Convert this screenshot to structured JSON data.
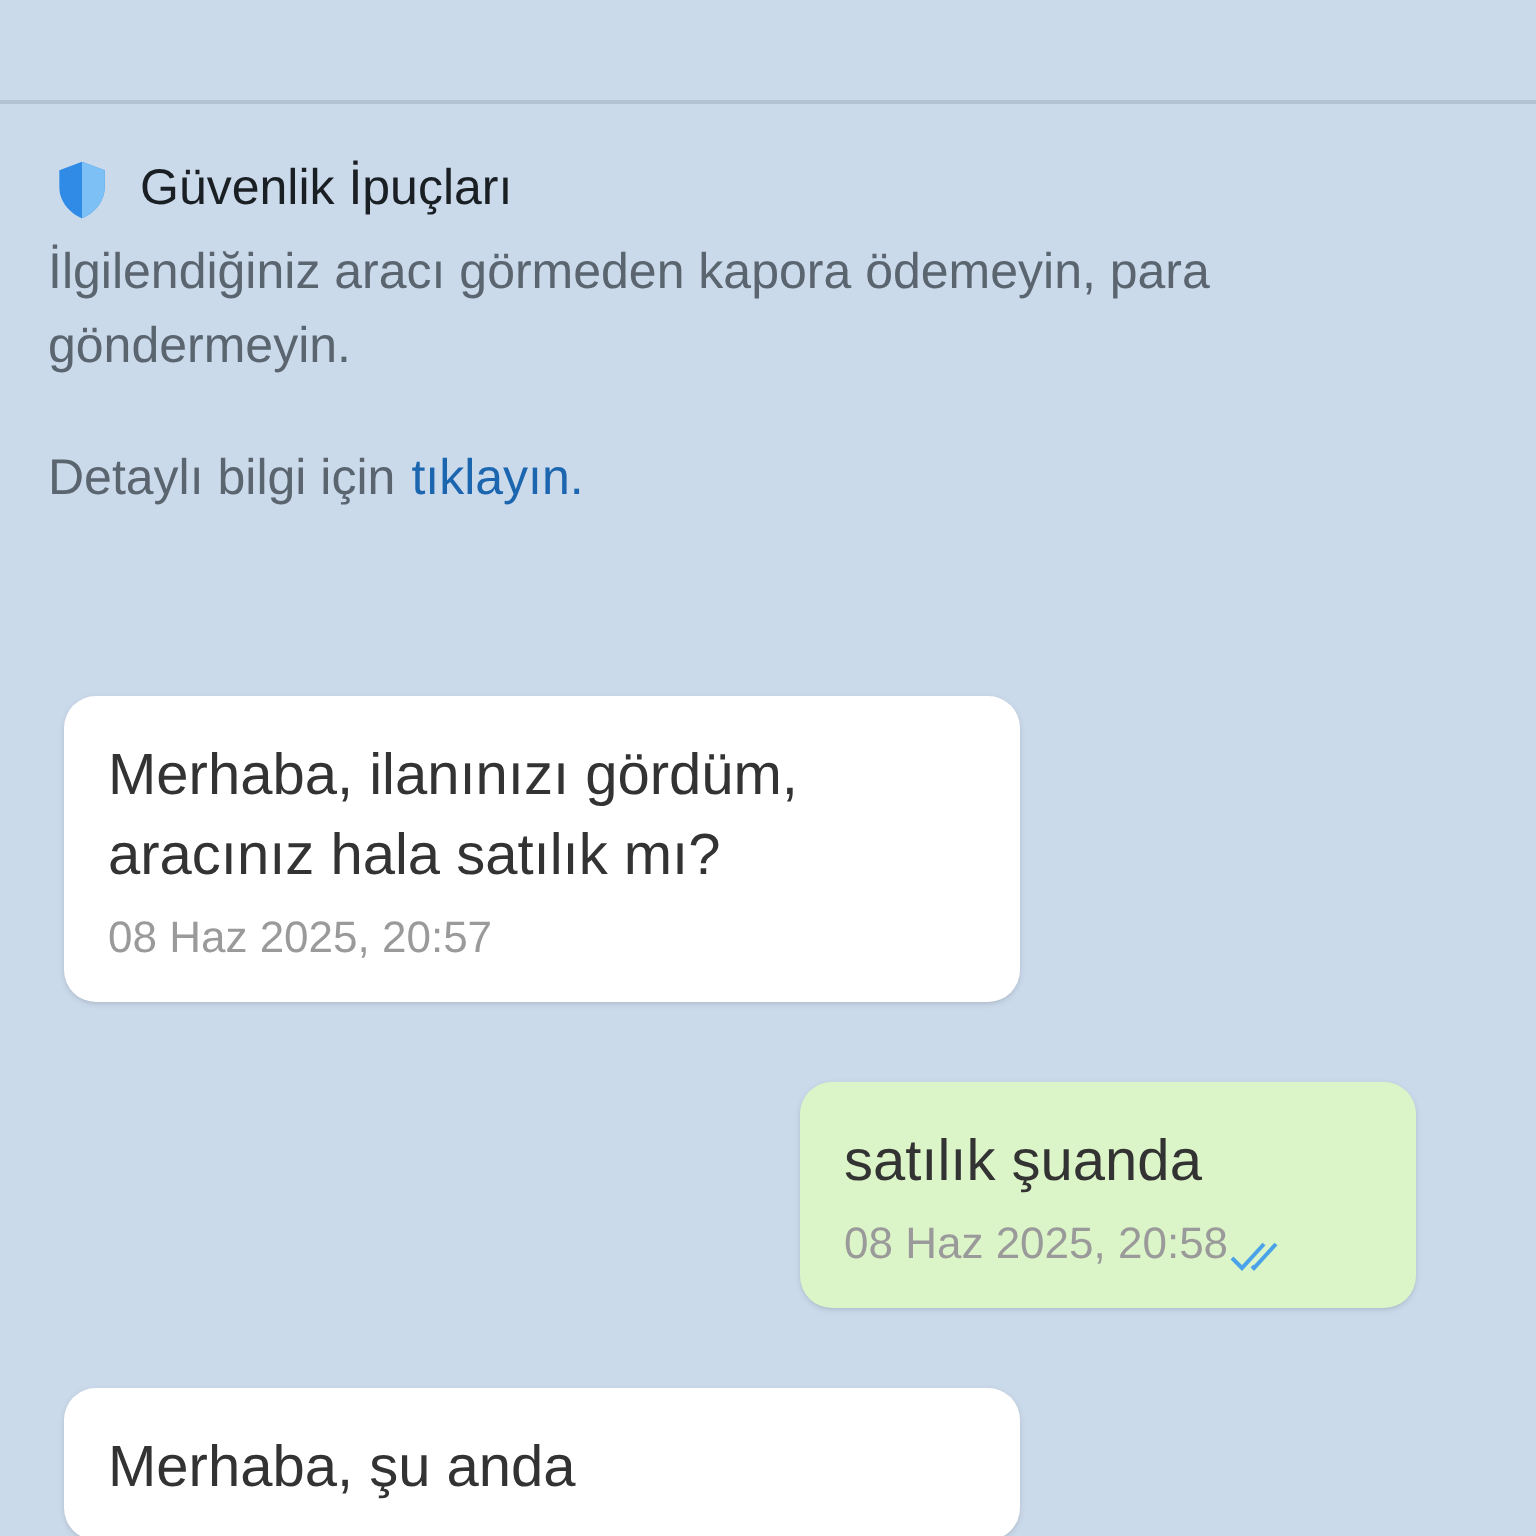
{
  "safety_tips": {
    "title": "Güvenlik İpuçları",
    "body": "İlgilendiğiniz aracı görmeden kapora ödemeyin, para göndermeyin.",
    "more_prefix": "Detaylı bilgi için",
    "more_link": "tıklayın."
  },
  "messages": [
    {
      "kind": "incoming",
      "text": "Merhaba, ilanınızı gördüm, aracınız hala satılık mı?",
      "time": "08 Haz 2025, 20:57"
    },
    {
      "kind": "outgoing",
      "text": "satılık şuanda",
      "time": "08 Haz 2025, 20:58",
      "read": true
    },
    {
      "kind": "incoming",
      "text": "Merhaba, şu anda"
    }
  ]
}
